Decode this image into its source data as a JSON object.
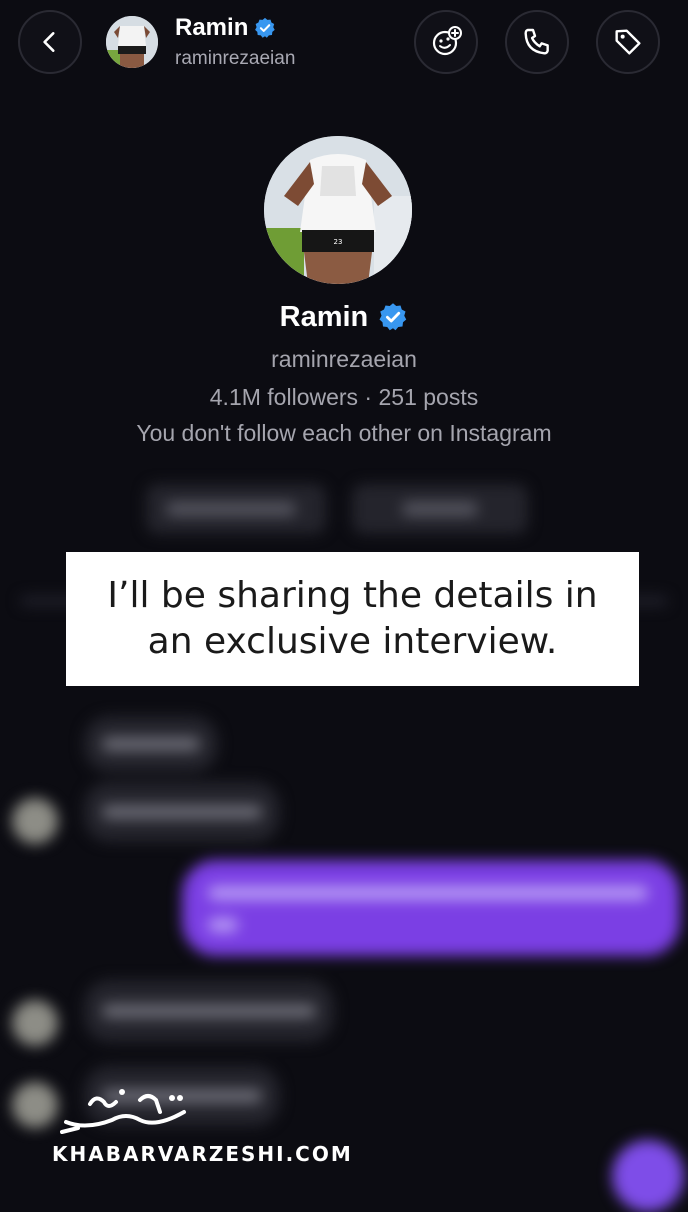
{
  "header": {
    "name": "Ramin",
    "username": "raminrezaeian",
    "icons": {
      "back": "chevron-left-icon",
      "effects": "effects-plus-icon",
      "call": "phone-icon",
      "tag": "tag-icon",
      "verified": "verified-badge-icon"
    }
  },
  "profile": {
    "name": "Ramin",
    "username": "raminrezaeian",
    "stats": "4.1M followers · 251 posts",
    "follow_note": "You don't follow each other on Instagram"
  },
  "caption": {
    "text": "I’ll be sharing the details in an exclusive interview."
  },
  "watermark": {
    "logo_text": "خبرورزشی",
    "site": "KHABARVARZESHI.COM"
  },
  "colors": {
    "background": "#0c0c12",
    "verified_blue": "#3897f0",
    "message_purple": "#7b3fe4",
    "secondary_text": "#a5a5ae"
  }
}
